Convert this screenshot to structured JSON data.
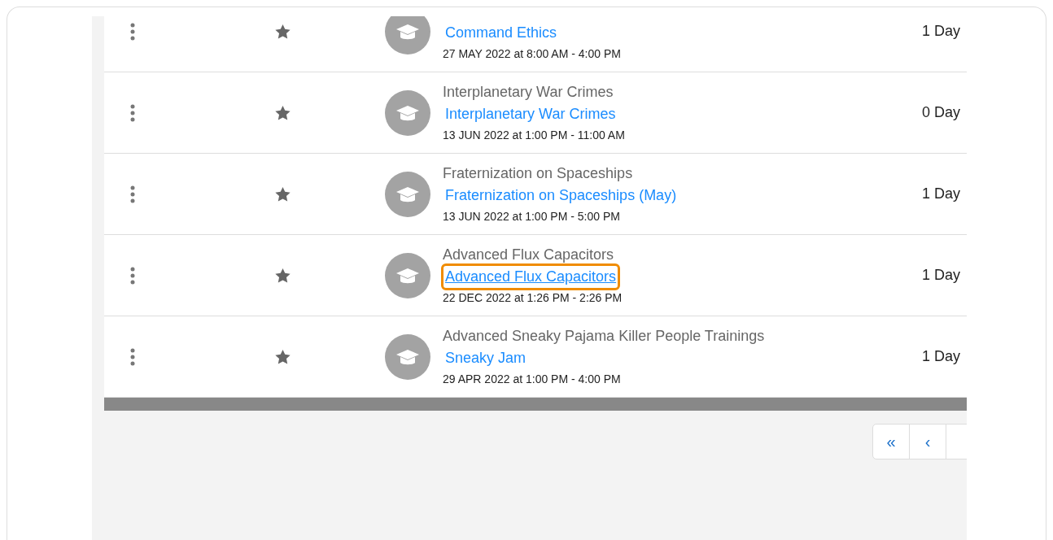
{
  "rows": [
    {
      "title": null,
      "link": "Command Ethics",
      "date": "27 MAY 2022 at 8:00 AM - 4:00 PM",
      "duration": "1 Day",
      "highlighted": false
    },
    {
      "title": "Interplanetary War Crimes",
      "link": "Interplanetary War Crimes",
      "date": "13 JUN 2022 at 1:00 PM - 11:00 AM",
      "duration": "0 Day",
      "highlighted": false
    },
    {
      "title": "Fraternization on Spaceships",
      "link": "Fraternization on Spaceships (May)",
      "date": "13 JUN 2022 at 1:00 PM - 5:00 PM",
      "duration": "1 Day",
      "highlighted": false
    },
    {
      "title": "Advanced Flux Capacitors",
      "link": "Advanced Flux Capacitors",
      "date": "22 DEC 2022 at 1:26 PM - 2:26 PM",
      "duration": "1 Day",
      "highlighted": true
    },
    {
      "title": "Advanced Sneaky Pajama Killer People Trainings",
      "link": "Sneaky Jam",
      "date": "29 APR 2022 at 1:00 PM - 4:00 PM",
      "duration": "1 Day",
      "highlighted": false
    }
  ],
  "pagination": [
    "«",
    "‹"
  ]
}
